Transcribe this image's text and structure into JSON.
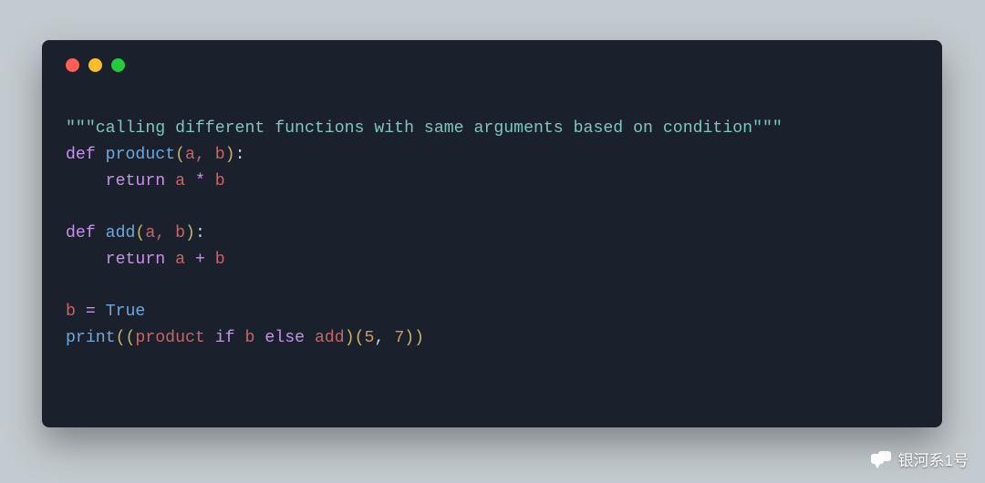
{
  "window": {
    "traffic": [
      "red",
      "yellow",
      "green"
    ]
  },
  "code": {
    "docstring_open": "\"\"\"",
    "docstring_text": "calling different functions with same arguments based on condition",
    "docstring_close": "\"\"\"",
    "kw_def": "def",
    "fn_product": "product",
    "fn_add": "add",
    "params": "a, b",
    "kw_return": "return",
    "expr_mul_a": "a",
    "op_mul": "*",
    "expr_mul_b": "b",
    "expr_add_a": "a",
    "op_add": "+",
    "expr_add_b": "b",
    "assign_lhs": "b",
    "op_eq": "=",
    "const_true": "True",
    "call_print": "print",
    "id_product": "product",
    "kw_if": "if",
    "id_b": "b",
    "kw_else": "else",
    "id_add": "add",
    "num_5": "5",
    "num_7": "7"
  },
  "watermark": {
    "label": "银河系1号"
  }
}
